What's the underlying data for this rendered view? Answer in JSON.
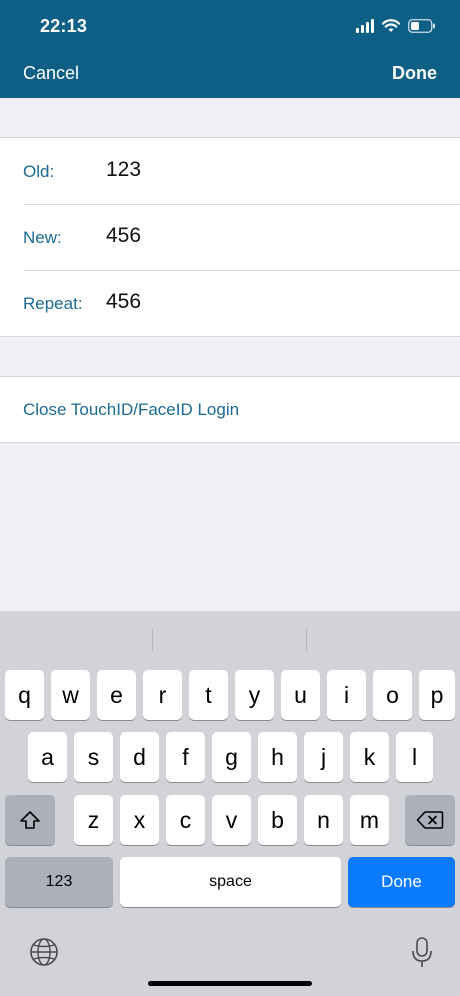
{
  "status_bar": {
    "time": "22:13"
  },
  "nav": {
    "cancel": "Cancel",
    "done": "Done"
  },
  "form": {
    "rows": [
      {
        "label": "Old:",
        "value": "123"
      },
      {
        "label": "New:",
        "value": "456"
      },
      {
        "label": "Repeat:",
        "value": "456"
      }
    ]
  },
  "action": {
    "label": "Close TouchID/FaceID Login"
  },
  "keyboard": {
    "row1": [
      "q",
      "w",
      "e",
      "r",
      "t",
      "y",
      "u",
      "i",
      "o",
      "p"
    ],
    "row2": [
      "a",
      "s",
      "d",
      "f",
      "g",
      "h",
      "j",
      "k",
      "l"
    ],
    "row3": [
      "z",
      "x",
      "c",
      "v",
      "b",
      "n",
      "m"
    ],
    "numbers_key": "123",
    "space_key": "space",
    "done_key": "Done",
    "icons": {
      "shift": "shift-icon",
      "delete": "backspace-icon",
      "globe": "globe-icon",
      "mic": "microphone-icon"
    }
  },
  "colors": {
    "nav_bg": "#0e5f86",
    "label": "#1a6a92",
    "done_key": "#0a7aff"
  }
}
